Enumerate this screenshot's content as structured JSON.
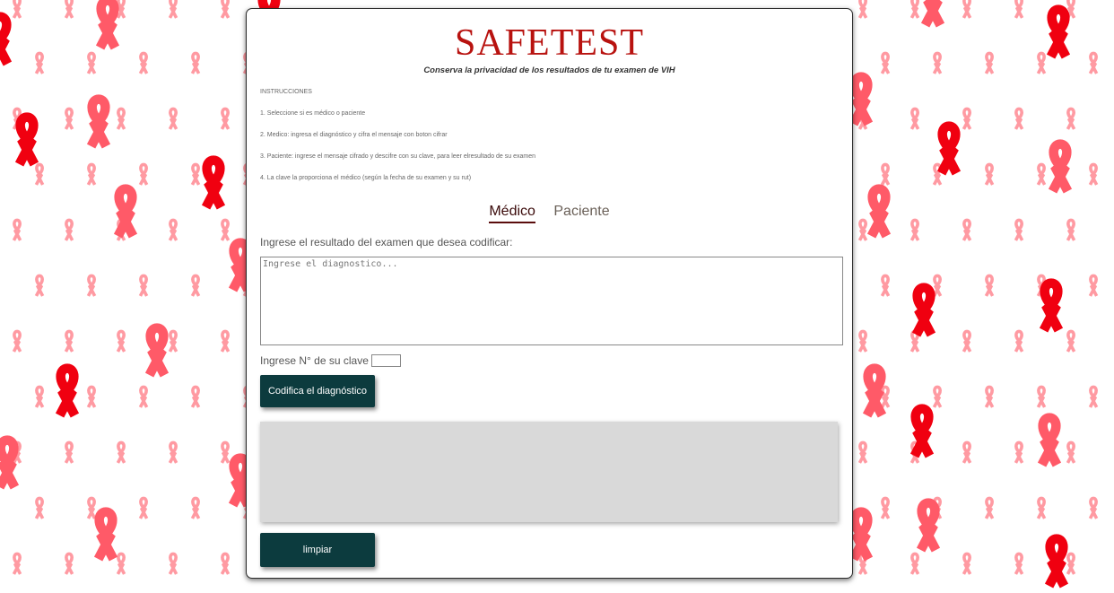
{
  "app": {
    "title": "SAFETEST",
    "subtitle": "Conserva la privacidad de los resultados de tu examen de VIH"
  },
  "instructions": {
    "heading": "INSTRUCCIONES",
    "items": [
      "1. Seleccione si es médico o paciente",
      "2. Medico: ingresa el diagnóstico y cifra el mensaje con boton cifrar",
      "3. Paciente: ingrese el mensaje cifrado y descifre con su clave, para leer elresultado de su examen",
      "4. La clave la proporciona el médico (según la fecha de su examen y su rut)"
    ]
  },
  "tabs": [
    {
      "label": "Médico",
      "active": true
    },
    {
      "label": "Paciente",
      "active": false
    }
  ],
  "form": {
    "prompt": "Ingrese el resultado del examen que desea codificar:",
    "diagnosis_placeholder": "Ingrese el diagnostico...",
    "diagnosis_value": "",
    "key_label": "Ingrese N° de su clave",
    "key_value": "",
    "encode_button": "Codifica el diagnóstico",
    "output_text": "",
    "clear_button": "limpiar"
  },
  "colors": {
    "title": "#b8120f",
    "button_bg": "#0c3b3e",
    "output_bg": "#d9d9d9",
    "ribbon_red": "#f00010",
    "ribbon_pink": "#ff5a68",
    "ribbon_light": "#ff9aa2"
  },
  "background": {
    "pattern": "ribbon-icon"
  }
}
